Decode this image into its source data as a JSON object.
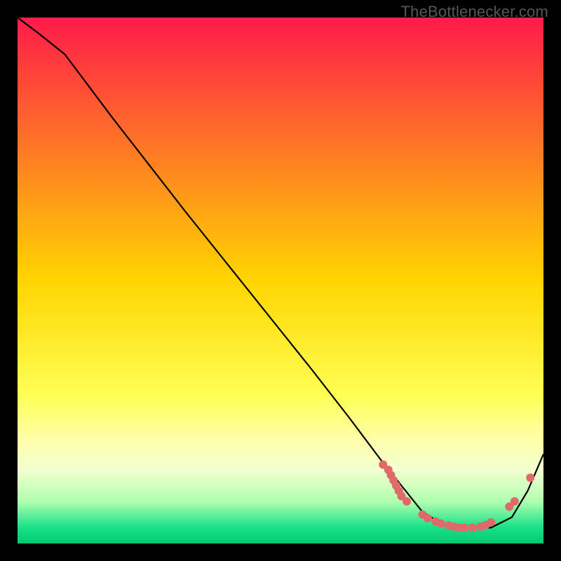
{
  "watermark": "TheBottlenecker.com",
  "chart_data": {
    "type": "line",
    "title": "",
    "xlabel": "",
    "ylabel": "",
    "xlim": [
      0,
      100
    ],
    "ylim": [
      0,
      100
    ],
    "background_gradient": {
      "stops": [
        {
          "pos": 0.0,
          "color": "#ff1b4a"
        },
        {
          "pos": 0.5,
          "color": "#ffd500"
        },
        {
          "pos": 0.72,
          "color": "#ffff55"
        },
        {
          "pos": 0.8,
          "color": "#ffffa8"
        },
        {
          "pos": 0.86,
          "color": "#f3ffd0"
        },
        {
          "pos": 0.92,
          "color": "#b0ffb0"
        },
        {
          "pos": 0.97,
          "color": "#17e086"
        },
        {
          "pos": 1.0,
          "color": "#06c96f"
        }
      ]
    },
    "series": [
      {
        "name": "bottleneck-curve",
        "color": "#000000",
        "x": [
          0,
          4,
          9,
          12,
          18,
          25,
          32,
          40,
          48,
          56,
          63,
          69,
          73,
          77,
          82,
          86,
          90,
          94,
          97,
          100
        ],
        "y": [
          100,
          97,
          93,
          89,
          81,
          72,
          63,
          53,
          43,
          33,
          24,
          16,
          11,
          6,
          3,
          3,
          3,
          5,
          10,
          17
        ]
      }
    ],
    "markers": {
      "name": "highlight-dots",
      "color": "#df6a6a",
      "radius": 6,
      "points": [
        {
          "x": 69.5,
          "y": 15
        },
        {
          "x": 70.5,
          "y": 14
        },
        {
          "x": 71.0,
          "y": 13
        },
        {
          "x": 71.5,
          "y": 12
        },
        {
          "x": 72.0,
          "y": 11
        },
        {
          "x": 72.5,
          "y": 10
        },
        {
          "x": 73.0,
          "y": 9
        },
        {
          "x": 74.0,
          "y": 8
        },
        {
          "x": 77.0,
          "y": 5.5
        },
        {
          "x": 78.0,
          "y": 4.8
        },
        {
          "x": 79.5,
          "y": 4.2
        },
        {
          "x": 80.5,
          "y": 3.8
        },
        {
          "x": 82.0,
          "y": 3.4
        },
        {
          "x": 83.0,
          "y": 3.2
        },
        {
          "x": 84.0,
          "y": 3.0
        },
        {
          "x": 85.0,
          "y": 3.0
        },
        {
          "x": 86.5,
          "y": 3.0
        },
        {
          "x": 88.0,
          "y": 3.2
        },
        {
          "x": 89.0,
          "y": 3.5
        },
        {
          "x": 90.0,
          "y": 4.0
        },
        {
          "x": 93.5,
          "y": 7.0
        },
        {
          "x": 94.5,
          "y": 8.0
        },
        {
          "x": 97.5,
          "y": 12.5
        }
      ]
    }
  }
}
